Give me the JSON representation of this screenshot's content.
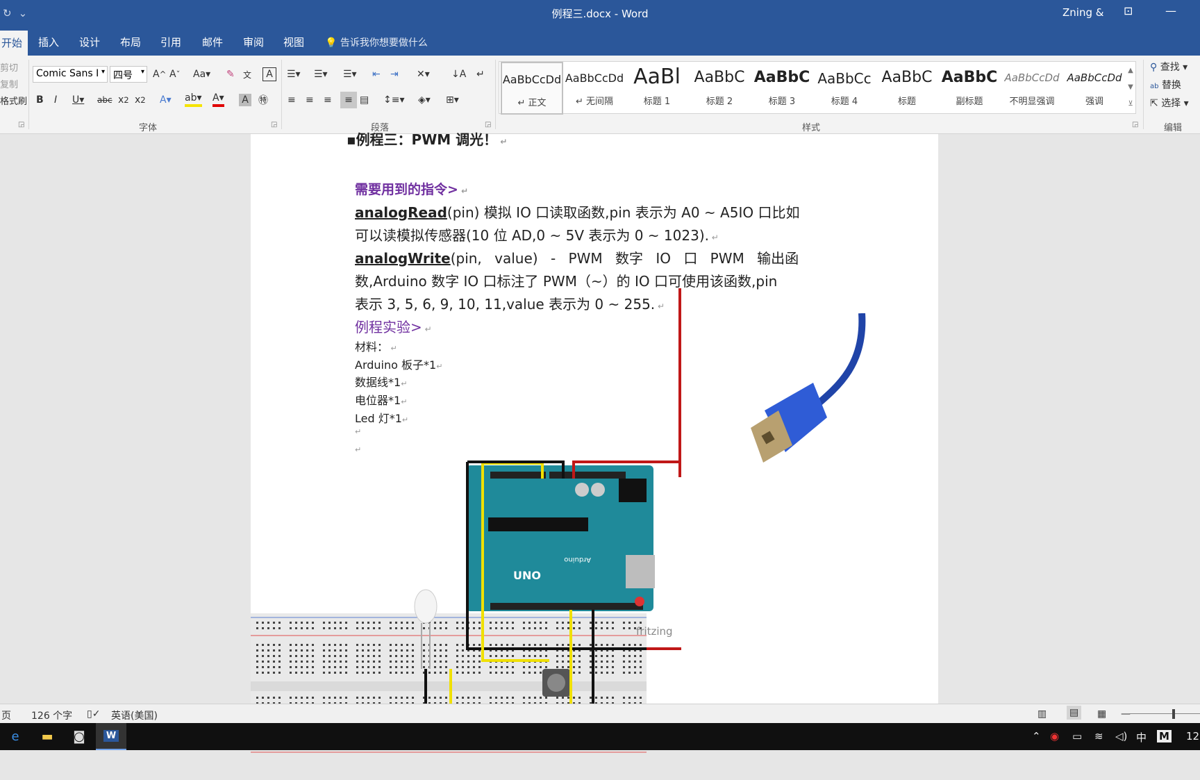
{
  "window": {
    "title": "例程三.docx  -  Word",
    "user": "Zning &"
  },
  "tabs": [
    "开始",
    "插入",
    "设计",
    "布局",
    "引用",
    "邮件",
    "审阅",
    "视图"
  ],
  "tell_me": "告诉我你想要做什么",
  "clipboard": {
    "cut": "剪切",
    "copy": "复制",
    "format_painter": "格式刷"
  },
  "font": {
    "name": "Comic Sans I",
    "size": "四号",
    "group_label": "字体"
  },
  "paragraph": {
    "group_label": "段落"
  },
  "styles": {
    "group_label": "样式",
    "items": [
      {
        "preview": "AaBbCcDd",
        "name": "正文"
      },
      {
        "preview": "AaBbCcDd",
        "name": "无间隔"
      },
      {
        "preview": "AaBl",
        "name": "标题 1"
      },
      {
        "preview": "AaBbC",
        "name": "标题 2"
      },
      {
        "preview": "AaBbC",
        "name": "标题 3"
      },
      {
        "preview": "AaBbCc",
        "name": "标题 4"
      },
      {
        "preview": "AaBbC",
        "name": "标题"
      },
      {
        "preview": "AaBbC",
        "name": "副标题"
      },
      {
        "preview": "AaBbCcDd",
        "name": "不明显强调"
      },
      {
        "preview": "AaBbCcDd",
        "name": "强调"
      }
    ]
  },
  "editing": {
    "find": "查找",
    "replace": "替换",
    "select": "选择",
    "group_label": "编辑"
  },
  "document": {
    "heading": "例程三：PWM 调光！",
    "section1": "需要用到的指令>",
    "analogread_name": "analogRead",
    "analogread_text1": "(pin) 模拟 IO 口读取函数,pin 表示为 A0 ~ A5IO 口比如",
    "analogread_text2": "可以读模拟传感器(10 位 AD,0 ~ 5V 表示为 0 ~ 1023).",
    "analogwrite_name": "analogWrite",
    "analogwrite_text1": "(pin, value) - PWM 数字 IO 口 PWM 输出函",
    "analogwrite_text2": "数,Arduino 数字 IO 口标注了 PWM（~）的 IO 口可使用该函数,pin",
    "analogwrite_text3": "表示 3, 5, 6, 9, 10, 11,value 表示为 0 ~ 255.",
    "section2": "例程实验>",
    "materials_label": "材料：",
    "materials": [
      "Arduino 板子*1",
      "数据线*1",
      "电位器*1",
      "Led 灯*1"
    ],
    "fritzing": "fritzing",
    "board_label_uno": "UNO",
    "board_label_arduino": "Arduino"
  },
  "status": {
    "page": "页",
    "word_count": "126 个字",
    "language": "英语(美国)"
  },
  "taskbar": {
    "ime": "中",
    "time": "12"
  }
}
